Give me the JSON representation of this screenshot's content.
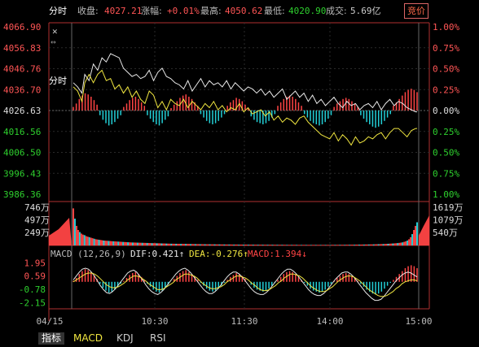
{
  "header": {
    "mode": "分时",
    "close_label": "收盘:",
    "close_value": "4027.21",
    "change_label": "涨幅:",
    "change_value": "+0.01%",
    "high_label": "最高:",
    "high_value": "4050.62",
    "low_label": "最低:",
    "low_value": "4020.90",
    "volume_label": "成交:",
    "volume_value": "5.69亿",
    "bid_button": "竞价"
  },
  "colors": {
    "up": "#ff4444",
    "down": "#22cfd6",
    "white_line": "#e8e8e8",
    "yellow_line": "#f0e640",
    "green_text": "#2ed02e",
    "axis": "#b03030"
  },
  "chart_data": [
    {
      "type": "line",
      "panel": "price",
      "y_left_ticks": [
        "4066.90",
        "4056.83",
        "4046.76",
        "4036.70",
        "4026.63",
        "4016.56",
        "4006.50",
        "3996.43",
        "3986.36"
      ],
      "y_right_ticks": [
        "1.00%",
        "0.75%",
        "0.50%",
        "0.25%",
        "0.00%",
        "0.25%",
        "0.50%",
        "0.75%",
        "1.00%"
      ],
      "ylim": [
        3986.36,
        4066.9
      ],
      "base": 4026.63,
      "x_labels": [
        "04/15",
        "10:30",
        "11:30",
        "14:00",
        "15:00"
      ],
      "series": [
        {
          "color": "white",
          "x": [
            0,
            3,
            6,
            8,
            11,
            14,
            17,
            20,
            23,
            26,
            29,
            32,
            35,
            38,
            41,
            44,
            47,
            50,
            53,
            56,
            59,
            62,
            65,
            68,
            71,
            74,
            77,
            80,
            83,
            86,
            89,
            92,
            95,
            98,
            101,
            104,
            107,
            110,
            113,
            116,
            119,
            122,
            125,
            128,
            131,
            134,
            137,
            140,
            143,
            146,
            149,
            152,
            155,
            158,
            161,
            164,
            167,
            170,
            173,
            176,
            179,
            182,
            185,
            188,
            191,
            194,
            197,
            200,
            203,
            206,
            209,
            212,
            215,
            218,
            221,
            224,
            227,
            230,
            233,
            236,
            239,
            240
          ],
          "values": [
            4040,
            4038,
            4035,
            4044,
            4041,
            4049,
            4046,
            4052,
            4050,
            4054,
            4053,
            4052,
            4047,
            4045,
            4043,
            4044,
            4042,
            4043,
            4046,
            4041,
            4045,
            4047,
            4043,
            4042,
            4040,
            4039,
            4037,
            4041,
            4036,
            4039,
            4042,
            4038,
            4041,
            4039,
            4040,
            4038,
            4041,
            4037,
            4040,
            4038,
            4036,
            4038,
            4037,
            4035,
            4037,
            4034,
            4036,
            4033,
            4035,
            4037,
            4032,
            4034,
            4036,
            4033,
            4035,
            4031,
            4034,
            4030,
            4032,
            4029,
            4031,
            4033,
            4030,
            4028,
            4031,
            4029,
            4030,
            4027,
            4029,
            4030,
            4028,
            4031,
            4027,
            4030,
            4032,
            4029,
            4031,
            4030,
            4028,
            4027,
            4026,
            4026
          ]
        },
        {
          "color": "yellow",
          "x": [
            0,
            3,
            6,
            8,
            11,
            14,
            17,
            20,
            23,
            26,
            29,
            32,
            35,
            38,
            41,
            44,
            47,
            50,
            53,
            56,
            59,
            62,
            65,
            68,
            71,
            74,
            77,
            80,
            83,
            86,
            89,
            92,
            95,
            98,
            101,
            104,
            107,
            110,
            113,
            116,
            119,
            122,
            125,
            128,
            131,
            134,
            137,
            140,
            143,
            146,
            149,
            152,
            155,
            158,
            161,
            164,
            167,
            170,
            173,
            176,
            179,
            182,
            185,
            188,
            191,
            194,
            197,
            200,
            203,
            206,
            209,
            212,
            215,
            218,
            221,
            224,
            227,
            230,
            233,
            236,
            239,
            240
          ],
          "values": [
            4038,
            4036,
            4031,
            4040,
            4044,
            4040,
            4044,
            4046,
            4041,
            4042,
            4037,
            4039,
            4035,
            4038,
            4033,
            4036,
            4032,
            4030,
            4036,
            4034,
            4028,
            4031,
            4027,
            4032,
            4030,
            4029,
            4032,
            4028,
            4031,
            4029,
            4027,
            4030,
            4028,
            4031,
            4027,
            4029,
            4026,
            4028,
            4027,
            4030,
            4026,
            4028,
            4025,
            4026,
            4027,
            4024,
            4026,
            4022,
            4024,
            4021,
            4023,
            4022,
            4020,
            4023,
            4024,
            4021,
            4019,
            4017,
            4015,
            4014,
            4013,
            4016,
            4012,
            4015,
            4013,
            4010,
            4014,
            4011,
            4012,
            4014,
            4013,
            4015,
            4016,
            4013,
            4016,
            4018,
            4018,
            4016,
            4014,
            4017,
            4018,
            4018
          ]
        }
      ]
    },
    {
      "type": "bar",
      "panel": "volume",
      "y_left_ticks": [
        "746万",
        "497万",
        "249万"
      ],
      "y_right_ticks": [
        "1619万",
        "1079万",
        "540万"
      ],
      "ylim": [
        0,
        790
      ],
      "values": [
        720,
        520,
        380,
        300,
        260,
        230,
        210,
        200,
        180,
        170,
        160,
        150,
        140,
        130,
        120,
        115,
        110,
        105,
        100,
        95,
        92,
        90,
        88,
        85,
        82,
        80,
        78,
        76,
        74,
        72,
        70,
        68,
        66,
        64,
        62,
        60,
        58,
        57,
        56,
        55,
        54,
        53,
        52,
        51,
        50,
        49,
        48,
        47,
        46,
        45,
        44,
        43,
        42,
        41,
        40,
        39,
        38,
        37,
        36,
        35,
        34,
        33,
        33,
        32,
        32,
        31,
        31,
        30,
        30,
        29,
        29,
        28,
        28,
        27,
        27,
        26,
        26,
        25,
        25,
        24,
        24,
        23,
        23,
        22,
        22,
        22,
        21,
        21,
        21,
        20,
        20,
        20,
        19,
        19,
        19,
        18,
        18,
        18,
        18,
        17,
        17,
        17,
        17,
        16,
        16,
        16,
        16,
        16,
        15,
        15,
        15,
        15,
        15,
        14,
        14,
        14,
        14,
        14,
        14,
        13,
        13,
        13,
        13,
        13,
        13,
        12,
        12,
        12,
        12,
        12,
        12,
        12,
        11,
        11,
        11,
        11,
        11,
        11,
        11,
        11,
        10,
        10,
        10,
        10,
        10,
        10,
        10,
        10,
        10,
        10,
        10,
        10,
        10,
        10,
        10,
        10,
        10,
        10,
        10,
        10,
        10,
        11,
        11,
        11,
        11,
        11,
        12,
        12,
        12,
        12,
        13,
        13,
        13,
        14,
        14,
        14,
        15,
        15,
        16,
        16,
        17,
        17,
        18,
        18,
        19,
        20,
        20,
        21,
        22,
        23,
        24,
        25,
        26,
        27,
        28,
        30,
        32,
        34,
        36,
        38,
        40,
        43,
        46,
        50,
        55,
        60,
        70,
        80,
        95,
        120,
        160,
        220,
        300,
        380,
        450
      ]
    },
    {
      "type": "bar",
      "panel": "macd",
      "title": "MACD (12,26,9)",
      "legend": [
        {
          "label": "DIF:0.421↑",
          "color": "#e8e8e8"
        },
        {
          "label": "DEA:-0.276↑",
          "color": "#f0e640"
        },
        {
          "label": "MACD:1.394↓",
          "color": "#ff4444"
        }
      ],
      "y_ticks": [
        "1.95",
        "0.59",
        "-0.78",
        "-2.15"
      ],
      "ylim": [
        -2.6,
        2.4
      ],
      "values": [
        0.1,
        0.4,
        0.8,
        1.1,
        1.3,
        1.2,
        1.0,
        0.7,
        0.3,
        -0.2,
        -0.6,
        -0.9,
        -1.1,
        -1.0,
        -0.8,
        -0.5,
        -0.2,
        0.1,
        0.4,
        0.7,
        0.9,
        1.0,
        0.8,
        0.5,
        0.2,
        -0.2,
        -0.5,
        -0.8,
        -1.0,
        -1.1,
        -0.9,
        -0.6,
        -0.3,
        0.0,
        0.3,
        0.6,
        0.9,
        1.1,
        1.2,
        1.0,
        0.8,
        0.5,
        0.2,
        -0.1,
        -0.4,
        -0.7,
        -0.9,
        -1.0,
        -0.9,
        -0.7,
        -0.4,
        -0.1,
        0.2,
        0.5,
        0.7,
        0.9,
        0.8,
        0.6,
        0.3,
        0.0,
        -0.3,
        -0.6,
        -0.8,
        -0.9,
        -1.0,
        -0.9,
        -0.7,
        -0.4,
        -0.1,
        0.2,
        0.5,
        0.8,
        1.0,
        1.1,
        1.0,
        0.8,
        0.5,
        0.2,
        -0.1,
        -0.4,
        -0.7,
        -0.9,
        -1.0,
        -1.1,
        -1.0,
        -0.8,
        -0.5,
        -0.2,
        0.1,
        0.4,
        0.6,
        0.8,
        0.9,
        0.8,
        0.6,
        0.4,
        0.1,
        -0.2,
        -0.5,
        -0.8,
        -1.0,
        -1.2,
        -1.3,
        -1.2,
        -1.0,
        -0.7,
        -0.4,
        -0.1,
        0.2,
        0.5,
        0.8,
        1.1,
        1.4,
        1.6,
        1.7,
        1.6,
        1.4
      ],
      "dif": [
        0.2,
        0.6,
        1.0,
        1.3,
        1.4,
        1.3,
        1.0,
        0.6,
        0.1,
        -0.4,
        -0.8,
        -1.1,
        -1.2,
        -1.0,
        -0.7,
        -0.3,
        0.1,
        0.5,
        0.9,
        1.1,
        1.2,
        1.0,
        0.6,
        0.2,
        -0.3,
        -0.7,
        -1.0,
        -1.2,
        -1.3,
        -1.1,
        -0.8,
        -0.4,
        0.0,
        0.4,
        0.8,
        1.1,
        1.3,
        1.4,
        1.2,
        0.9,
        0.5,
        0.1,
        -0.3,
        -0.7,
        -1.0,
        -1.2,
        -1.2,
        -1.0,
        -0.7,
        -0.3,
        0.1,
        0.5,
        0.8,
        1.0,
        1.0,
        0.8,
        0.5,
        0.1,
        -0.3,
        -0.7,
        -1.0,
        -1.2,
        -1.3,
        -1.3,
        -1.1,
        -0.8,
        -0.4,
        0.0,
        0.4,
        0.8,
        1.1,
        1.3,
        1.3,
        1.1,
        0.8,
        0.4,
        0.0,
        -0.4,
        -0.8,
        -1.1,
        -1.3,
        -1.4,
        -1.4,
        -1.2,
        -0.9,
        -0.5,
        -0.1,
        0.3,
        0.6,
        0.9,
        1.0,
        1.0,
        0.8,
        0.5,
        0.1,
        -0.3,
        -0.7,
        -1.1,
        -1.4,
        -1.7,
        -1.9,
        -1.9,
        -1.8,
        -1.5,
        -1.1,
        -0.7,
        -0.3,
        0.1,
        0.4,
        0.7,
        0.9,
        1.0,
        0.9,
        0.7,
        0.5
      ],
      "dea": [
        0.0,
        0.2,
        0.4,
        0.6,
        0.8,
        0.9,
        0.9,
        0.8,
        0.6,
        0.3,
        0.0,
        -0.3,
        -0.5,
        -0.6,
        -0.6,
        -0.5,
        -0.3,
        -0.1,
        0.2,
        0.4,
        0.6,
        0.6,
        0.5,
        0.3,
        0.1,
        -0.2,
        -0.4,
        -0.6,
        -0.8,
        -0.8,
        -0.7,
        -0.5,
        -0.3,
        -0.1,
        0.2,
        0.4,
        0.6,
        0.8,
        0.8,
        0.7,
        0.6,
        0.4,
        0.1,
        -0.2,
        -0.4,
        -0.6,
        -0.7,
        -0.7,
        -0.6,
        -0.5,
        -0.3,
        0.0,
        0.2,
        0.4,
        0.6,
        0.6,
        0.5,
        0.4,
        0.2,
        -0.1,
        -0.3,
        -0.6,
        -0.8,
        -0.9,
        -0.9,
        -0.8,
        -0.6,
        -0.4,
        -0.1,
        0.1,
        0.4,
        0.6,
        0.8,
        0.8,
        0.7,
        0.6,
        0.4,
        0.1,
        -0.2,
        -0.5,
        -0.7,
        -0.9,
        -1.0,
        -1.0,
        -0.9,
        -0.7,
        -0.5,
        -0.2,
        0.1,
        0.3,
        0.5,
        0.6,
        0.6,
        0.5,
        0.3,
        0.1,
        -0.2,
        -0.5,
        -0.8,
        -1.0,
        -1.2,
        -1.4,
        -1.5,
        -1.5,
        -1.4,
        -1.2,
        -1.0,
        -0.7,
        -0.5,
        -0.2,
        0.0,
        0.1,
        0.2,
        0.2,
        0.1
      ]
    }
  ],
  "tabs": {
    "t1": "指标",
    "t2": "MACD",
    "t3": "KDJ",
    "t4": "RSI"
  }
}
